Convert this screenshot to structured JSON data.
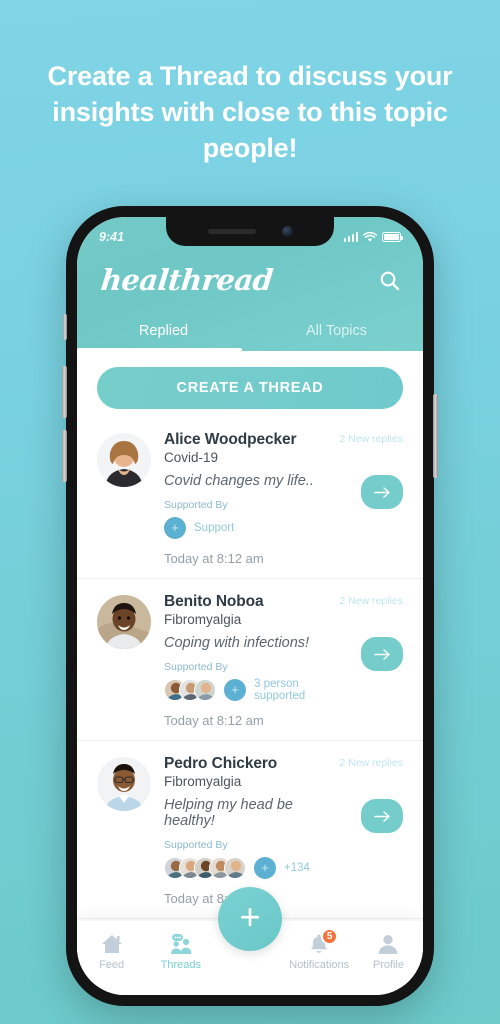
{
  "promo": {
    "headline": "Create a Thread to discuss your insights with close to this topic people!"
  },
  "statusbar": {
    "time": "9:41",
    "signal_icon": "signal-bars-icon",
    "wifi_icon": "wifi-icon",
    "battery_icon": "battery-icon"
  },
  "header": {
    "logo": "healthread",
    "search_icon": "search-icon"
  },
  "tabs": [
    {
      "label": "Replied",
      "active": true
    },
    {
      "label": "All Topics",
      "active": false
    }
  ],
  "cta": {
    "label": "CREATE A THREAD"
  },
  "cards": [
    {
      "name": "Alice Woodpecker",
      "topic": "Covid-19",
      "quote": "Covid changes my life..",
      "new_replies": "2 New replies",
      "supported_label": "Supported By",
      "support_text": "Support",
      "avatar_count": 0,
      "timestamp": "Today at 8:12 am",
      "go_icon": "arrow-right-icon",
      "plus_icon": "plus-icon"
    },
    {
      "name": "Benito Noboa",
      "topic": "Fibromyalgia",
      "quote": "Coping with infections!",
      "new_replies": "2 New replies",
      "supported_label": "Supported By",
      "support_text": "3 person supported",
      "avatar_count": 3,
      "timestamp": "Today at 8:12 am",
      "go_icon": "arrow-right-icon",
      "plus_icon": "plus-icon"
    },
    {
      "name": "Pedro Chickero",
      "topic": "Fibromyalgia",
      "quote": "Helping my head be healthy!",
      "new_replies": "2 New replies",
      "supported_label": "Supported By",
      "support_text": "+134",
      "avatar_count": 5,
      "timestamp": "Today at 8:12 am",
      "go_icon": "arrow-right-icon",
      "plus_icon": "plus-icon"
    }
  ],
  "bottomnav": {
    "items": [
      {
        "label": "Feed",
        "icon": "home-icon",
        "active": false
      },
      {
        "label": "Threads",
        "icon": "people-chat-icon",
        "active": true
      },
      {
        "label": "Notifications",
        "icon": "bell-icon",
        "active": false,
        "badge": "5"
      },
      {
        "label": "Profile",
        "icon": "person-icon",
        "active": false
      }
    ],
    "fab_icon": "plus-icon"
  },
  "colors": {
    "background": "#7FD4E5",
    "header_teal": "#6FC8C6",
    "accent_teal": "#74CCCB",
    "support_blue": "#5CB0D2",
    "badge_orange": "#F4743B",
    "inactive_nav": "#b6c2cb"
  }
}
